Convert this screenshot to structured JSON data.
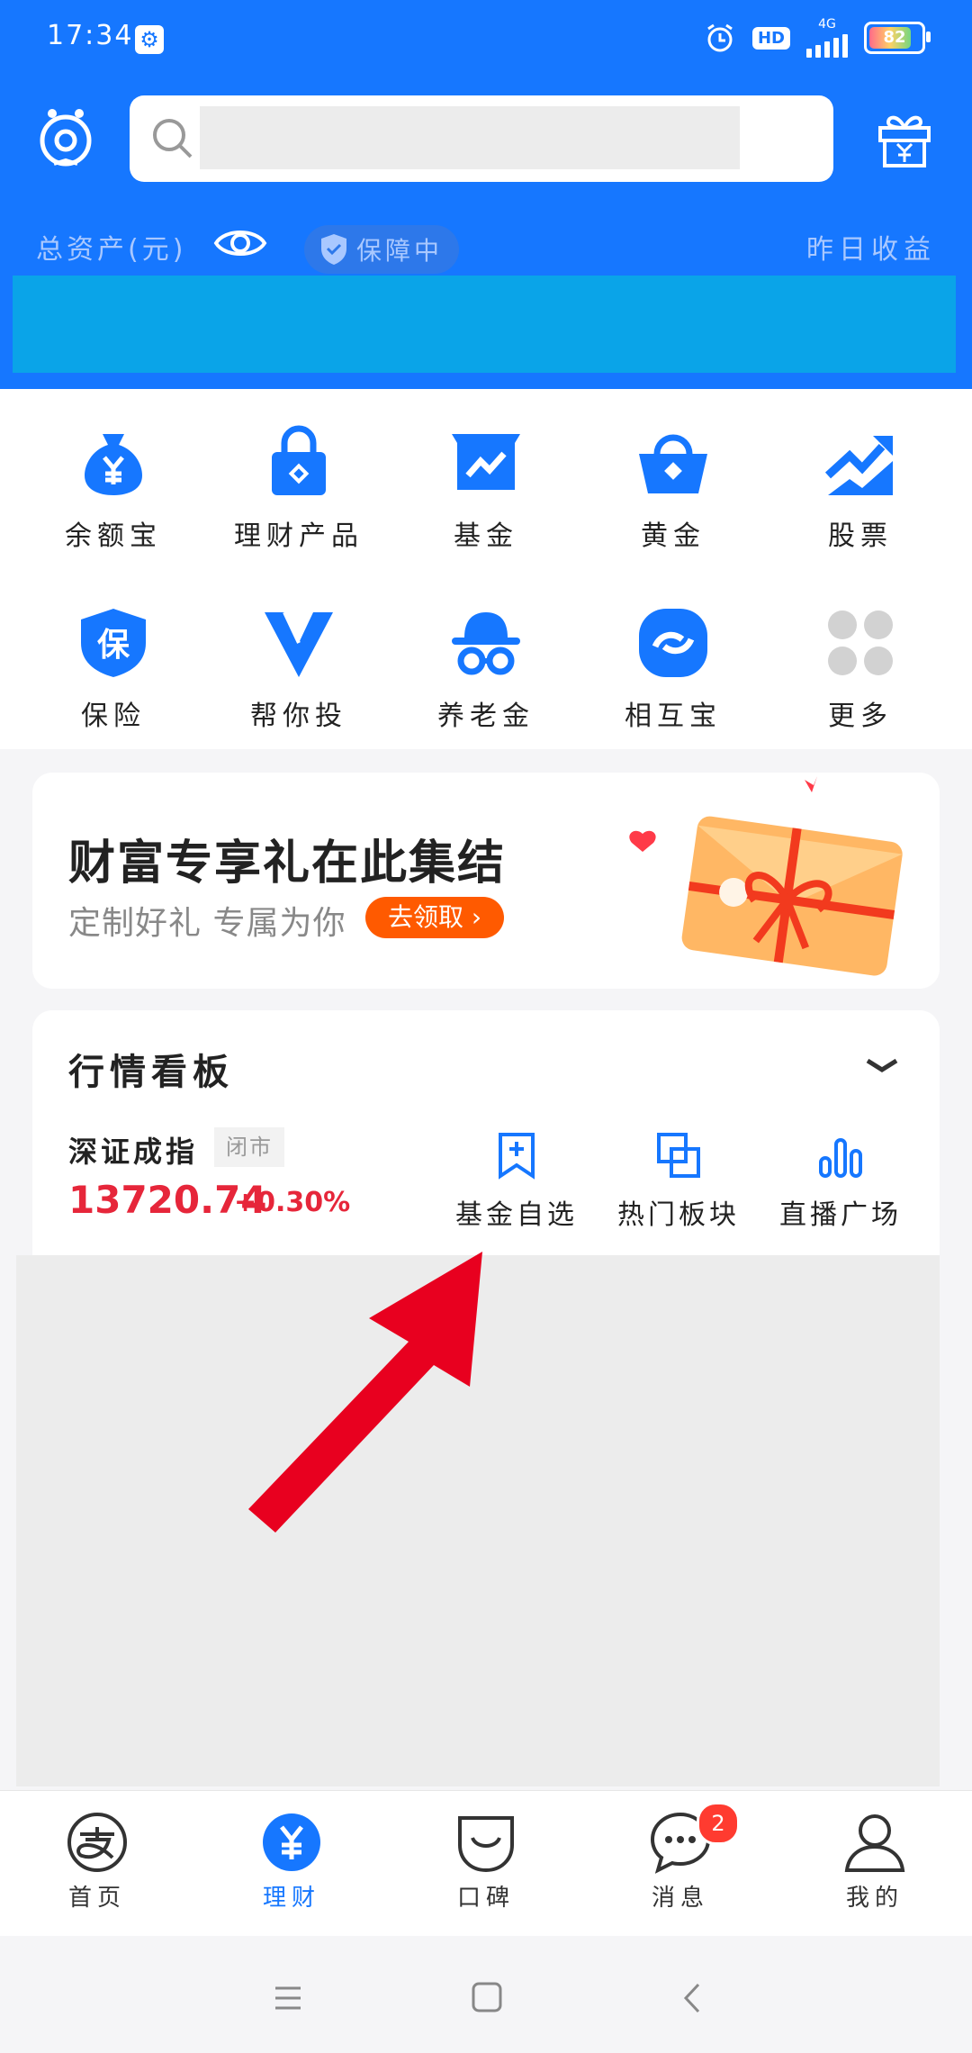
{
  "status_bar": {
    "time": "17:34",
    "network": "4G",
    "hd": "HD",
    "battery": "82",
    "battery_level": 0.82
  },
  "search": {
    "placeholder": ""
  },
  "assets": {
    "total_label": "总资产(元)",
    "protect_label": "保障中",
    "yesterday_label": "昨日收益"
  },
  "grid": {
    "items": [
      {
        "label": "余额宝",
        "icon": "money-bag-icon"
      },
      {
        "label": "理财产品",
        "icon": "lock-bag-icon"
      },
      {
        "label": "基金",
        "icon": "fund-chart-icon"
      },
      {
        "label": "黄金",
        "icon": "gold-basket-icon"
      },
      {
        "label": "股票",
        "icon": "stock-trend-icon"
      },
      {
        "label": "保险",
        "icon": "insurance-shield-icon"
      },
      {
        "label": "帮你投",
        "icon": "help-invest-icon"
      },
      {
        "label": "养老金",
        "icon": "pension-icon"
      },
      {
        "label": "相互宝",
        "icon": "mutual-aid-icon"
      },
      {
        "label": "更多",
        "icon": "more-grid-icon"
      }
    ]
  },
  "promo": {
    "title": "财富专享礼在此集结",
    "subtitle": "定制好礼 专属为你",
    "button": "去领取"
  },
  "market": {
    "title": "行情看板",
    "index_name": "深证成指",
    "status": "闭市",
    "index_value": "13720.74",
    "index_change": "+0.30%",
    "actions": [
      {
        "label": "基金自选",
        "icon": "bookmark-plus-icon"
      },
      {
        "label": "热门板块",
        "icon": "layers-icon"
      },
      {
        "label": "直播广场",
        "icon": "bars-icon"
      }
    ]
  },
  "tabs": [
    {
      "label": "首页",
      "icon": "alipay-home-icon",
      "active": false
    },
    {
      "label": "理财",
      "icon": "yuan-coin-icon",
      "active": true
    },
    {
      "label": "口碑",
      "icon": "koubei-bag-icon",
      "active": false
    },
    {
      "label": "消息",
      "icon": "chat-bubble-icon",
      "active": false,
      "badge": "2"
    },
    {
      "label": "我的",
      "icon": "person-icon",
      "active": false
    }
  ],
  "colors": {
    "brand": "#1677ff",
    "accent_red": "#e6263a",
    "promo_orange": "#ff5a00"
  }
}
